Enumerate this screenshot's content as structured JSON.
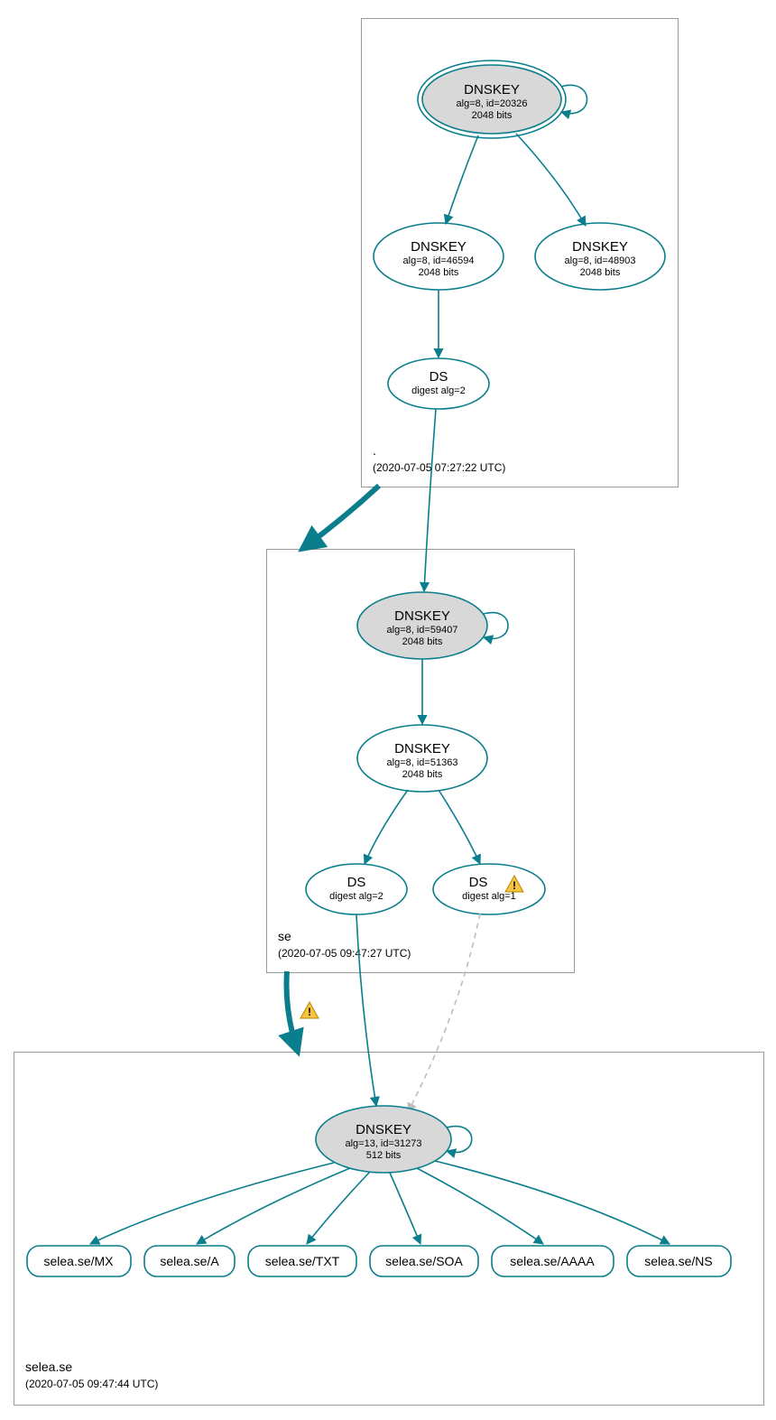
{
  "zones": {
    "root": {
      "name": ".",
      "timestamp": "(2020-07-05 07:27:22 UTC)"
    },
    "se": {
      "name": "se",
      "timestamp": "(2020-07-05 09:47:27 UTC)"
    },
    "selea": {
      "name": "selea.se",
      "timestamp": "(2020-07-05 09:47:44 UTC)"
    }
  },
  "nodes": {
    "root_ksk": {
      "title": "DNSKEY",
      "line1": "alg=8, id=20326",
      "line2": "2048 bits"
    },
    "root_zsk1": {
      "title": "DNSKEY",
      "line1": "alg=8, id=46594",
      "line2": "2048 bits"
    },
    "root_zsk2": {
      "title": "DNSKEY",
      "line1": "alg=8, id=48903",
      "line2": "2048 bits"
    },
    "root_ds": {
      "title": "DS",
      "line1": "digest alg=2"
    },
    "se_ksk": {
      "title": "DNSKEY",
      "line1": "alg=8, id=59407",
      "line2": "2048 bits"
    },
    "se_zsk": {
      "title": "DNSKEY",
      "line1": "alg=8, id=51363",
      "line2": "2048 bits"
    },
    "se_ds1": {
      "title": "DS",
      "line1": "digest alg=2"
    },
    "se_ds2": {
      "title": "DS",
      "line1": "digest alg=1"
    },
    "selea_ksk": {
      "title": "DNSKEY",
      "line1": "alg=13, id=31273",
      "line2": "512 bits"
    }
  },
  "rrsets": {
    "mx": "selea.se/MX",
    "a": "selea.se/A",
    "txt": "selea.se/TXT",
    "soa": "selea.se/SOA",
    "aaaa": "selea.se/AAAA",
    "ns": "selea.se/NS"
  },
  "colors": {
    "stroke": "#0a7e8c",
    "fill_secure": "#d8d8d8",
    "zone_border": "#999999",
    "dashed": "#bdbdbd",
    "warn": "#e4b400"
  },
  "chart_data": {
    "type": "graph",
    "description": "DNSSEC authentication chain for selea.se",
    "zones": [
      {
        "id": "root",
        "name": ".",
        "timestamp": "2020-07-05 07:27:22 UTC"
      },
      {
        "id": "se",
        "name": "se",
        "timestamp": "2020-07-05 09:47:27 UTC"
      },
      {
        "id": "selea",
        "name": "selea.se",
        "timestamp": "2020-07-05 09:47:44 UTC"
      }
    ],
    "nodes": [
      {
        "id": "root_ksk",
        "zone": "root",
        "type": "DNSKEY",
        "alg": 8,
        "key_id": 20326,
        "bits": 2048,
        "secure": true,
        "trust_anchor": true
      },
      {
        "id": "root_zsk1",
        "zone": "root",
        "type": "DNSKEY",
        "alg": 8,
        "key_id": 46594,
        "bits": 2048
      },
      {
        "id": "root_zsk2",
        "zone": "root",
        "type": "DNSKEY",
        "alg": 8,
        "key_id": 48903,
        "bits": 2048
      },
      {
        "id": "root_ds",
        "zone": "root",
        "type": "DS",
        "digest_alg": 2
      },
      {
        "id": "se_ksk",
        "zone": "se",
        "type": "DNSKEY",
        "alg": 8,
        "key_id": 59407,
        "bits": 2048,
        "secure": true
      },
      {
        "id": "se_zsk",
        "zone": "se",
        "type": "DNSKEY",
        "alg": 8,
        "key_id": 51363,
        "bits": 2048
      },
      {
        "id": "se_ds1",
        "zone": "se",
        "type": "DS",
        "digest_alg": 2
      },
      {
        "id": "se_ds2",
        "zone": "se",
        "type": "DS",
        "digest_alg": 1,
        "warning": true
      },
      {
        "id": "selea_ksk",
        "zone": "selea",
        "type": "DNSKEY",
        "alg": 13,
        "key_id": 31273,
        "bits": 512,
        "secure": true
      },
      {
        "id": "rr_mx",
        "zone": "selea",
        "type": "RRset",
        "label": "selea.se/MX"
      },
      {
        "id": "rr_a",
        "zone": "selea",
        "type": "RRset",
        "label": "selea.se/A"
      },
      {
        "id": "rr_txt",
        "zone": "selea",
        "type": "RRset",
        "label": "selea.se/TXT"
      },
      {
        "id": "rr_soa",
        "zone": "selea",
        "type": "RRset",
        "label": "selea.se/SOA"
      },
      {
        "id": "rr_aaaa",
        "zone": "selea",
        "type": "RRset",
        "label": "selea.se/AAAA"
      },
      {
        "id": "rr_ns",
        "zone": "selea",
        "type": "RRset",
        "label": "selea.se/NS"
      }
    ],
    "edges": [
      {
        "from": "root_ksk",
        "to": "root_ksk",
        "self": true
      },
      {
        "from": "root_ksk",
        "to": "root_zsk1"
      },
      {
        "from": "root_ksk",
        "to": "root_zsk2"
      },
      {
        "from": "root_zsk1",
        "to": "root_ds"
      },
      {
        "from": "root_ds",
        "to": "se_ksk"
      },
      {
        "from": "root",
        "to": "se",
        "delegation": true
      },
      {
        "from": "se_ksk",
        "to": "se_ksk",
        "self": true
      },
      {
        "from": "se_ksk",
        "to": "se_zsk"
      },
      {
        "from": "se_zsk",
        "to": "se_ds1"
      },
      {
        "from": "se_zsk",
        "to": "se_ds2"
      },
      {
        "from": "se_ds1",
        "to": "selea_ksk"
      },
      {
        "from": "se_ds2",
        "to": "selea_ksk",
        "style": "dashed"
      },
      {
        "from": "se",
        "to": "selea",
        "delegation": true,
        "warning": true
      },
      {
        "from": "selea_ksk",
        "to": "selea_ksk",
        "self": true
      },
      {
        "from": "selea_ksk",
        "to": "rr_mx"
      },
      {
        "from": "selea_ksk",
        "to": "rr_a"
      },
      {
        "from": "selea_ksk",
        "to": "rr_txt"
      },
      {
        "from": "selea_ksk",
        "to": "rr_soa"
      },
      {
        "from": "selea_ksk",
        "to": "rr_aaaa"
      },
      {
        "from": "selea_ksk",
        "to": "rr_ns"
      }
    ]
  }
}
